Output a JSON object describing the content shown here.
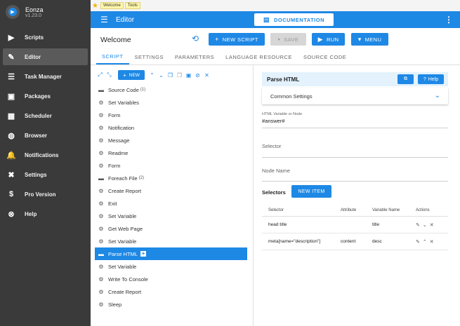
{
  "app": {
    "name": "Eonza",
    "version": "v1.23.0"
  },
  "sidebar": {
    "items": [
      {
        "label": "Scripts",
        "icon": "play-circle-icon",
        "glyph": "▶",
        "active": false
      },
      {
        "label": "Editor",
        "icon": "edit-icon",
        "glyph": "✎",
        "active": true
      },
      {
        "label": "Task Manager",
        "icon": "task-list-icon",
        "glyph": "☰",
        "active": false
      },
      {
        "label": "Packages",
        "icon": "packages-icon",
        "glyph": "▣",
        "active": false
      },
      {
        "label": "Scheduler",
        "icon": "calendar-icon",
        "glyph": "▦",
        "active": false
      },
      {
        "label": "Browser",
        "icon": "globe-icon",
        "glyph": "◍",
        "active": false
      },
      {
        "label": "Notifications",
        "icon": "bell-icon",
        "glyph": "🔔",
        "active": false
      },
      {
        "label": "Settings",
        "icon": "tools-icon",
        "glyph": "✖",
        "active": false
      },
      {
        "label": "Pro Version",
        "icon": "dollar-icon",
        "glyph": "$",
        "active": false
      },
      {
        "label": "Help",
        "icon": "lifebuoy-icon",
        "glyph": "⊗",
        "active": false
      }
    ]
  },
  "tabstrip": {
    "tabs": [
      "Welcome",
      "Tools"
    ]
  },
  "appbar": {
    "title": "Editor",
    "doc_button": "DOCUMENTATION"
  },
  "header": {
    "script_name": "Welcome",
    "new_script": "NEW SCRIPT",
    "save": "SAVE",
    "run": "RUN",
    "menu": "MENU"
  },
  "tabs": [
    "SCRIPT",
    "SETTINGS",
    "PARAMETERS",
    "LANGUAGE RESOURCE",
    "SOURCE CODE"
  ],
  "tree_toolbar": {
    "new_label": "NEW"
  },
  "tree": [
    {
      "label": "Source Code",
      "type": "folder",
      "count": "(1)"
    },
    {
      "label": "Set Variables",
      "type": "gear",
      "count": ""
    },
    {
      "label": "Form",
      "type": "gear",
      "count": ""
    },
    {
      "label": "Notification",
      "type": "gear",
      "count": ""
    },
    {
      "label": "Message",
      "type": "gear",
      "count": ""
    },
    {
      "label": "Readme",
      "type": "gear",
      "count": ""
    },
    {
      "label": "Form",
      "type": "gear",
      "count": ""
    },
    {
      "label": "Foreach File",
      "type": "folder",
      "count": "(2)"
    },
    {
      "label": "Create Report",
      "type": "gear",
      "count": ""
    },
    {
      "label": "Exit",
      "type": "gear",
      "count": ""
    },
    {
      "label": "Set Variable",
      "type": "gear",
      "count": ""
    },
    {
      "label": "Get Web Page",
      "type": "gear",
      "count": ""
    },
    {
      "label": "Set Variable",
      "type": "gear",
      "count": ""
    },
    {
      "label": "Parse HTML",
      "type": "folder",
      "count": "",
      "selected": true
    },
    {
      "label": "Set Variable",
      "type": "gear",
      "count": ""
    },
    {
      "label": "Write To Console",
      "type": "gear",
      "count": ""
    },
    {
      "label": "Create Report",
      "type": "gear",
      "count": ""
    },
    {
      "label": "Sleep",
      "type": "gear",
      "count": ""
    }
  ],
  "panel": {
    "title": "Parse HTML",
    "help_label": "Help",
    "common_settings": "Common Settings",
    "field_html_label": "HTML Variable or Node",
    "field_html_value": "#answer#",
    "field_selector_placeholder": "Selector",
    "field_node_placeholder": "Node Name",
    "selectors_label": "Selectors",
    "new_item": "NEW ITEM",
    "table": {
      "headers": [
        "Selector",
        "Attribute",
        "Variable Name",
        "Actions"
      ],
      "rows": [
        {
          "selector": "head title",
          "attribute": "",
          "variable": "title"
        },
        {
          "selector": "meta[name=\"description\"]",
          "attribute": "content",
          "variable": "desc"
        }
      ]
    }
  },
  "colors": {
    "accent": "#1e88e5",
    "sidebar": "#3a3a3a",
    "panel_header": "#e3f2fd"
  }
}
